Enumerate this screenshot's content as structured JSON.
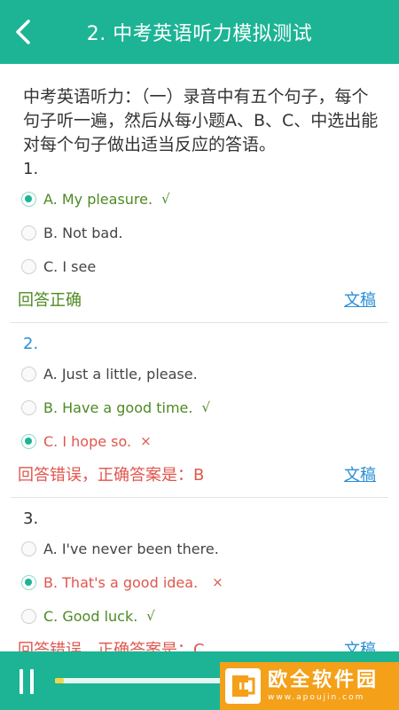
{
  "header": {
    "title": "2. 中考英语听力模拟测试"
  },
  "intro": "中考英语听力：（一）录音中有五个句子，每个句子听一遍，然后从每小题A、B、C、中选出能对每个句子做出适当反应的答语。",
  "doc_link_label": "文稿",
  "questions": [
    {
      "number": "1.",
      "options": [
        {
          "label": "A. My pleasure.",
          "mark": "√"
        },
        {
          "label": "B. Not bad.",
          "mark": ""
        },
        {
          "label": "C. I see",
          "mark": ""
        }
      ],
      "result": "回答正确"
    },
    {
      "number": "2.",
      "options": [
        {
          "label": "A. Just a little, please.",
          "mark": ""
        },
        {
          "label": "B. Have a good time.",
          "mark": "√"
        },
        {
          "label": "C. I hope so.",
          "mark": "×"
        }
      ],
      "result": "回答错误，正确答案是：B"
    },
    {
      "number": "3.",
      "options": [
        {
          "label": "A. I've never been there.",
          "mark": ""
        },
        {
          "label": "B. That's a good idea.",
          "mark": "×"
        },
        {
          "label": "C. Good luck.",
          "mark": "√"
        }
      ],
      "result": "回答错误，正确答案是：C"
    }
  ],
  "player": {
    "progress_fraction": 0.05
  },
  "watermark": {
    "name": "欧全软件园",
    "url": "www.apoujin.com"
  },
  "colors": {
    "accent": "#1cb495",
    "correct": "#4d8a22",
    "wrong": "#e0564d",
    "link": "#2a8fd6",
    "watermark_bg": "#f4a019"
  },
  "icons": {
    "back": "chevron-left-icon",
    "pause": "pause-icon",
    "radio_checked": "radio-checked-icon",
    "radio_unchecked": "radio-unchecked-icon"
  }
}
